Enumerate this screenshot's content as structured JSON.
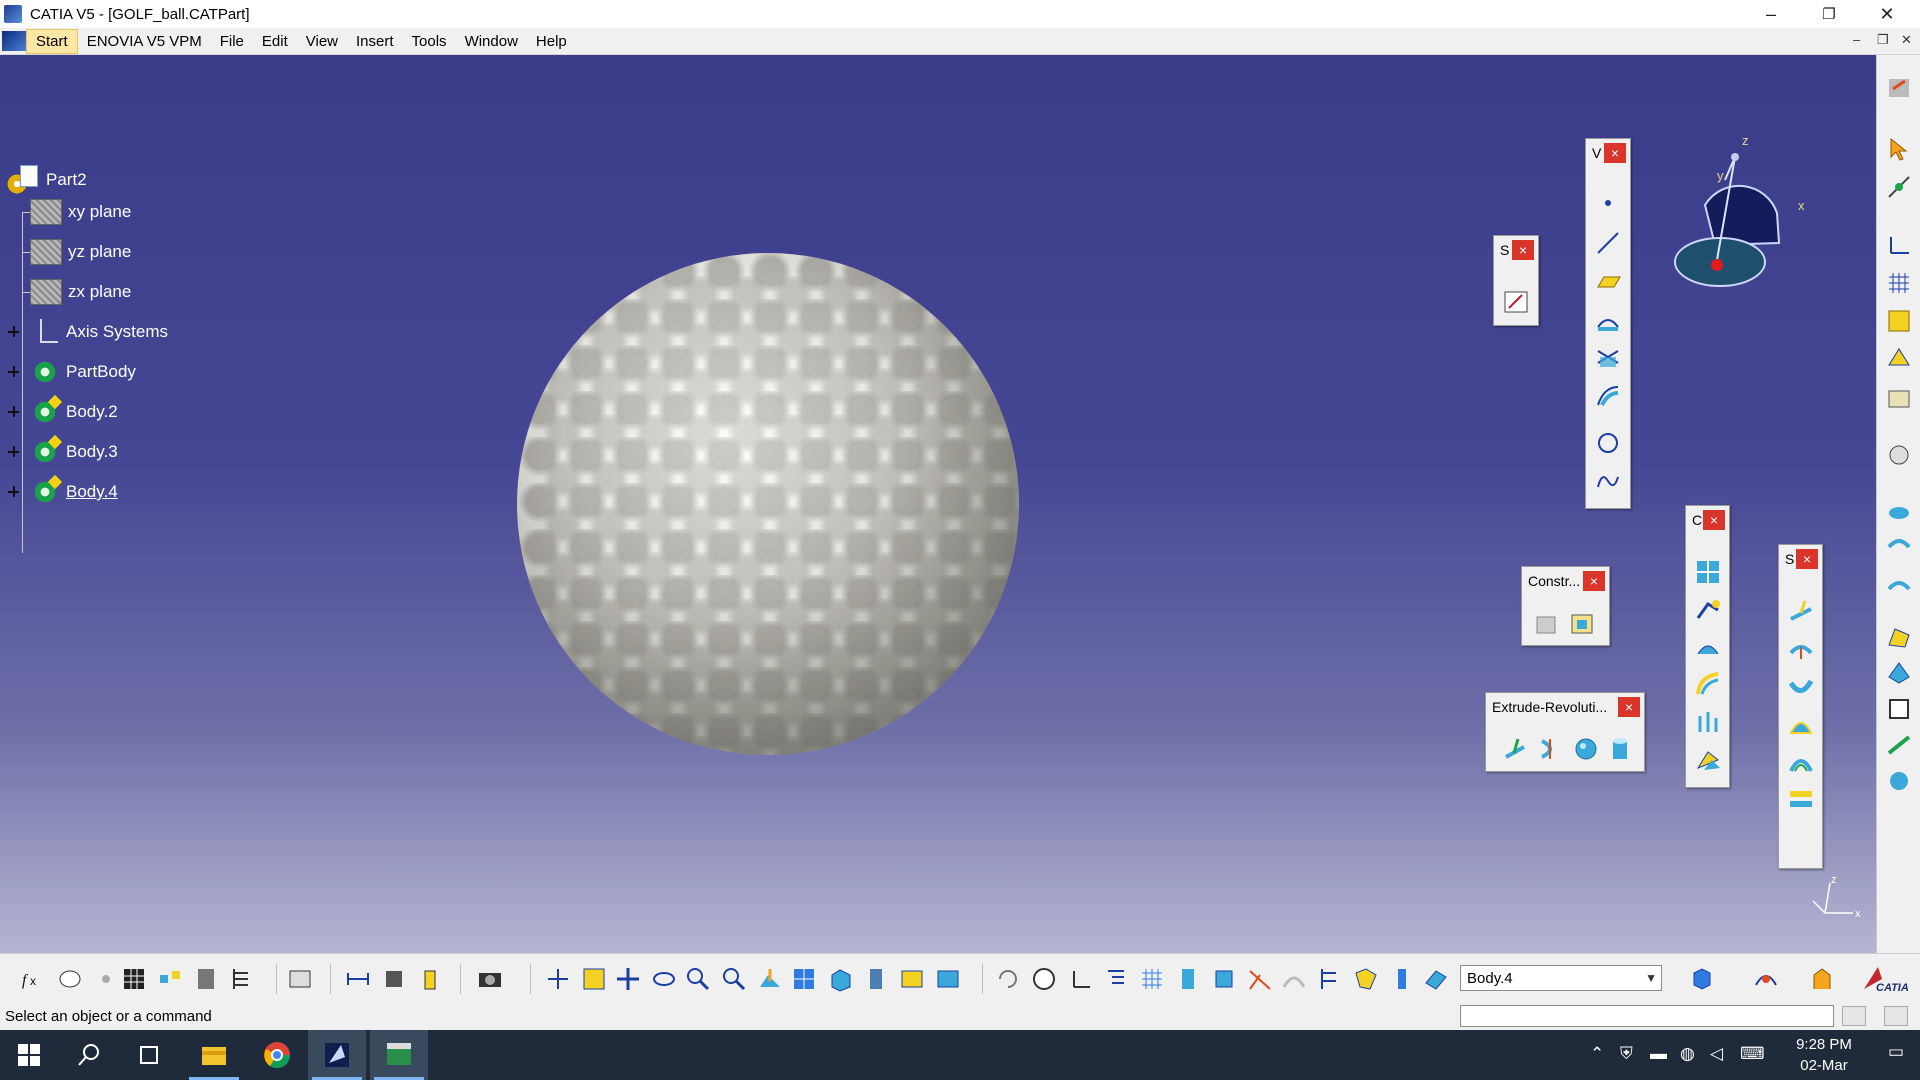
{
  "window": {
    "title": "CATIA V5 - [GOLF_ball.CATPart]",
    "minimize_glyph": "–",
    "restore_glyph": "❐",
    "close_glyph": "✕"
  },
  "menubar": {
    "items": [
      "Start",
      "ENOVIA V5 VPM",
      "File",
      "Edit",
      "View",
      "Insert",
      "Tools",
      "Window",
      "Help"
    ],
    "mdi_minimize": "–",
    "mdi_restore": "❐",
    "mdi_close": "✕"
  },
  "tree": {
    "root": "Part2",
    "items": [
      {
        "label": "xy plane",
        "icon": "plane-icon"
      },
      {
        "label": "yz plane",
        "icon": "plane-icon"
      },
      {
        "label": "zx plane",
        "icon": "plane-icon"
      },
      {
        "label": "Axis Systems",
        "icon": "axis-systems-icon"
      },
      {
        "label": "PartBody",
        "icon": "part-body-icon"
      },
      {
        "label": "Body.2",
        "icon": "body-icon"
      },
      {
        "label": "Body.3",
        "icon": "body-icon"
      },
      {
        "label": "Body.4",
        "icon": "body-icon"
      }
    ]
  },
  "toolbars": {
    "wireframe_title": "V",
    "sketcher_title": "S",
    "constraints_title": "Constr...",
    "operations_title": "C",
    "surfaces_title": "S",
    "extrude_title": "Extrude-Revoluti...",
    "close_glyph": "×"
  },
  "compass": {
    "x_label": "x",
    "y_label": "y",
    "z_label": "z"
  },
  "axis_triad": {
    "z_label": "z",
    "x_label": "x"
  },
  "current_body": "Body.4",
  "statusbar": {
    "message": "Select an object or a command"
  },
  "taskbar": {
    "time": "9:28 PM",
    "date": "02-Mar"
  },
  "colors": {
    "viewport_top": "#3a3c8a",
    "viewport_bottom": "#b5b6d2",
    "close_red": "#d9352b",
    "taskbar": "#1f2b3a"
  }
}
